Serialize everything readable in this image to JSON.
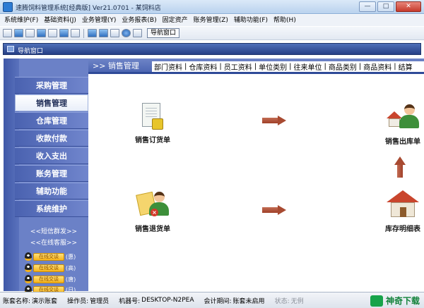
{
  "window": {
    "title": "速腾饲料管理系统[经典版] Ver21.0701 - 某饲料店",
    "controls": {
      "minimize": "—",
      "maximize": "□",
      "close": "✕"
    }
  },
  "menubar": [
    "系统维护(F)",
    "基础资料(J)",
    "业务管理(Y)",
    "业务报表(B)",
    "固定资产",
    "账务管理(Z)",
    "辅助功能(F)",
    "帮助(H)"
  ],
  "toolbar": {
    "nav_window_button": "导航窗口"
  },
  "nav_panel_title": "导航窗口",
  "sidebar": {
    "items": [
      "采购管理",
      "销售管理",
      "仓库管理",
      "收款付款",
      "收入支出",
      "账务管理",
      "辅助功能",
      "系统维护"
    ],
    "active_index": 1,
    "links": [
      "<<短信群发>>",
      "<<在线客服>>"
    ],
    "qq_badge_text": "在线交谈",
    "qq_tags": [
      "(惠)",
      "(高)",
      "(唐)",
      "(日)"
    ]
  },
  "tabs": {
    "current": ">> 销售管理",
    "items": [
      "部门资料",
      "仓库资料",
      "员工资料",
      "单位类别",
      "往来单位",
      "商品类别",
      "商品资料",
      "结算"
    ]
  },
  "tiles": {
    "sales_order": "销售订货单",
    "sales_return": "销售退货单",
    "sales_outbound": "销售出库单",
    "stock_detail": "库存明细表"
  },
  "status": {
    "account_name_label": "账套名称:",
    "account_name_value": "演示账套",
    "operator_label": "操作员:",
    "operator_value": "管理员",
    "machine_label": "机器号:",
    "machine_value": "DESKTOP-N2PEA",
    "period_label": "会计期间:",
    "period_value": "账套未启用",
    "state_label": "状态:",
    "state_value": "无例"
  },
  "watermark": "神奇下载",
  "colors": {
    "sidebar": "#6b81c7",
    "tab_bar": "#4e67b3",
    "arrow": "#a84a31"
  }
}
